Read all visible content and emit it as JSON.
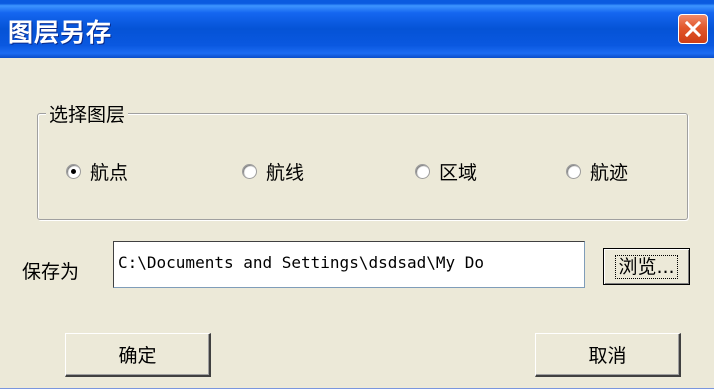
{
  "window": {
    "title": "图层另存"
  },
  "layer_group": {
    "legend": "选择图层",
    "options": [
      {
        "label": "航点",
        "checked": true
      },
      {
        "label": "航线",
        "checked": false
      },
      {
        "label": "区域",
        "checked": false
      },
      {
        "label": "航迹",
        "checked": false
      }
    ]
  },
  "save": {
    "label": "保存为",
    "path_value": "C:\\Documents and Settings\\dsdsad\\My Do",
    "browse_label": "浏览..."
  },
  "buttons": {
    "ok_label": "确定",
    "cancel_label": "取消"
  },
  "colors": {
    "title_bar": "#0553d6",
    "close_button": "#e2582c",
    "dialog_bg": "#ece9d8"
  }
}
